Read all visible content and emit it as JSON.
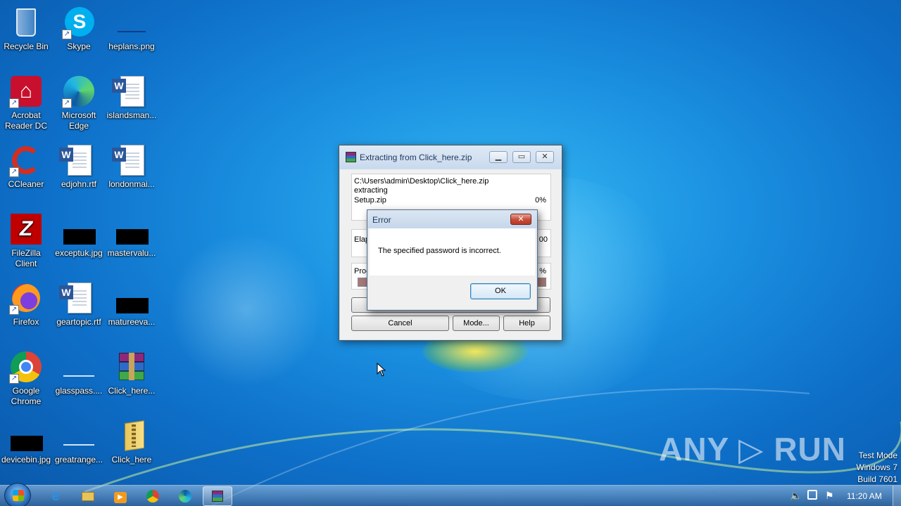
{
  "desktop": {
    "icons": [
      {
        "label": "Recycle Bin"
      },
      {
        "label": "Skype"
      },
      {
        "label": "heplans.png"
      },
      {
        "label": "Acrobat Reader DC"
      },
      {
        "label": "Microsoft Edge"
      },
      {
        "label": "islandsman..."
      },
      {
        "label": "CCleaner"
      },
      {
        "label": "edjohn.rtf"
      },
      {
        "label": "londonmai..."
      },
      {
        "label": "FileZilla Client"
      },
      {
        "label": "exceptuk.jpg"
      },
      {
        "label": "mastervalu..."
      },
      {
        "label": "Firefox"
      },
      {
        "label": "geartopic.rtf"
      },
      {
        "label": "matureeva..."
      },
      {
        "label": "Google Chrome"
      },
      {
        "label": "glasspass...."
      },
      {
        "label": "Click_here..."
      },
      {
        "label": "devicebin.jpg"
      },
      {
        "label": "greatrange..."
      },
      {
        "label": "Click_here"
      }
    ]
  },
  "extract_window": {
    "title": "Extracting from Click_here.zip",
    "path": "C:\\Users\\admin\\Desktop\\Click_here.zip",
    "status": "extracting",
    "file": "Setup.zip",
    "file_percent": "0%",
    "elapsed_label": "Elap",
    "elapsed_value": "00",
    "processed_label": "Proc",
    "processed_percent": "%",
    "cancel_label": "Cancel",
    "mode_label": "Mode...",
    "help_label": "Help"
  },
  "error_dialog": {
    "title": "Error",
    "message": "The specified password is incorrect.",
    "ok_label": "OK"
  },
  "watermark": {
    "text": "ANY ▷ RUN",
    "mode_line1": "Test Mode",
    "mode_line2": "Windows 7",
    "mode_line3": "Build 7601"
  },
  "taskbar": {
    "clock": "11:20 AM",
    "apps": [
      "ie-icon",
      "explorer-icon",
      "media-player-icon",
      "chrome-icon",
      "edge-icon",
      "winrar-icon"
    ]
  }
}
